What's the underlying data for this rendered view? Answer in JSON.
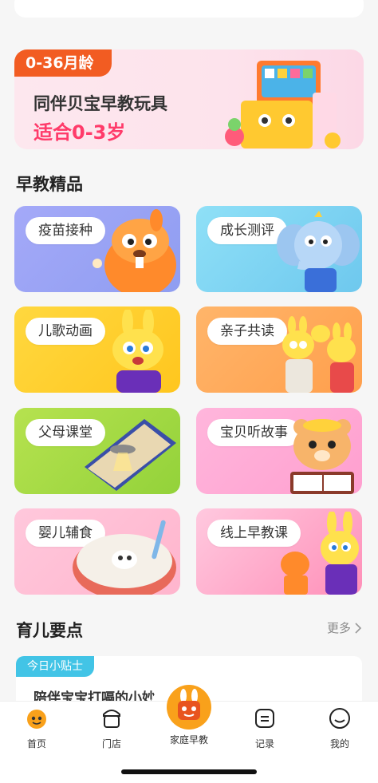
{
  "banner": {
    "tag": "0-36月龄",
    "line1": "同伴贝宝早教玩具",
    "line2": "适合0-3岁"
  },
  "section_premium": {
    "title": "早教精品"
  },
  "cards": [
    {
      "label": "疫苗接种",
      "bg": "#9aa3f5"
    },
    {
      "label": "成长测评",
      "bg": "#8fd7f5"
    },
    {
      "label": "儿歌动画",
      "bg": "#ffd23b"
    },
    {
      "label": "亲子共读",
      "bg": "#ffaa5c"
    },
    {
      "label": "父母课堂",
      "bg": "#a8dc4a"
    },
    {
      "label": "宝贝听故事",
      "bg": "#ffa9d3"
    },
    {
      "label": "婴儿辅食",
      "bg": "#ffc2d6"
    },
    {
      "label": "线上早教课",
      "bg": "#ffc7dd"
    }
  ],
  "section_tips": {
    "title": "育儿要点",
    "more": "更多"
  },
  "tip": {
    "tag": "今日小贴士",
    "text": "陪伴宝宝打嗝的小妙招"
  },
  "tabbar": {
    "home": "首页",
    "store": "门店",
    "center": "家庭早教",
    "record": "记录",
    "mine": "我的"
  }
}
